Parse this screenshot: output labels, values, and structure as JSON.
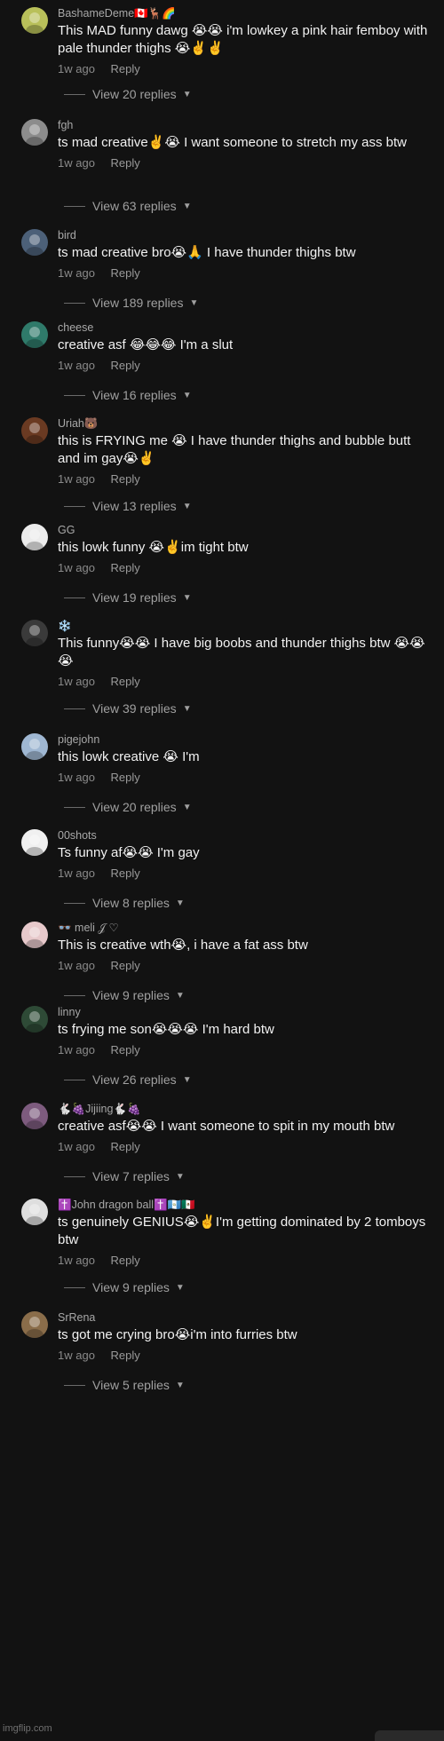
{
  "theme": {
    "background": "#121212",
    "text": "#f2f2f2",
    "muted": "#a8a8a8"
  },
  "comments": [
    {
      "username": "BashameDeme🇨🇦🦌🌈",
      "text": "This MAD funny dawg 😭😭 i'm lowkey a pink hair femboy with pale thunder thighs 😭✌️✌️",
      "time": "1w ago",
      "reply_label": "Reply",
      "replies_label": "View 20 replies",
      "avatar_color": "#b9c05a",
      "avatar_icon": "anime-avatar-icon"
    },
    {
      "username": "fgh",
      "text": "ts mad creative✌️😭 I want someone to stretch my ass btw",
      "time": "1w ago",
      "reply_label": "Reply",
      "replies_label": "View 63 replies",
      "avatar_color": "#8c8c8c",
      "avatar_icon": "person-avatar-icon"
    },
    {
      "username": "bird",
      "text": "ts mad creative bro😭🙏 I have thunder thighs btw",
      "time": "1w ago",
      "reply_label": "Reply",
      "replies_label": "View 189 replies",
      "avatar_color": "#4c6078",
      "avatar_icon": "bird-avatar-icon"
    },
    {
      "username": "cheese",
      "text": "creative asf 😂😂😂 I'm a slut",
      "time": "1w ago",
      "reply_label": "Reply",
      "replies_label": "View 16 replies",
      "avatar_color": "#2f7a6a",
      "avatar_icon": "smile-avatar-icon"
    },
    {
      "username": "Uriah🐻",
      "text": "this is FRYING me 😭 I have thunder thighs and bubble butt and im gay😭✌️",
      "time": "1w ago",
      "reply_label": "Reply",
      "replies_label": "View 13 replies",
      "avatar_color": "#6a3a22",
      "avatar_icon": "bear-avatar-icon"
    },
    {
      "username": "GG",
      "text": "this lowk funny 😭✌️im tight btw",
      "time": "1w ago",
      "reply_label": "Reply",
      "replies_label": "View 19 replies",
      "avatar_color": "#ececec",
      "avatar_icon": "mask-avatar-icon"
    },
    {
      "username": "❄️",
      "text": "This funny😭😭 I have big boobs and thunder thighs btw 😭😭😭",
      "time": "1w ago",
      "reply_label": "Reply",
      "replies_label": "View 39 replies",
      "avatar_color": "#3a3a3a",
      "avatar_icon": "dark-avatar-icon"
    },
    {
      "username": "pigejohn",
      "text": "this lowk creative 😭 I'm",
      "time": "1w ago",
      "reply_label": "Reply",
      "replies_label": "View 20 replies",
      "avatar_color": "#9fb7d2",
      "avatar_icon": "pigeon-avatar-icon"
    },
    {
      "username": "00shots",
      "text": "Ts funny af😭😭 I'm gay",
      "time": "1w ago",
      "reply_label": "Reply",
      "replies_label": "View 8 replies",
      "avatar_color": "#f0f0f0",
      "avatar_icon": "cartoon-avatar-icon"
    },
    {
      "username": "👓 meli 𝒥 ♡",
      "text": "This is creative wth😭, i have a fat ass btw",
      "time": "1w ago",
      "reply_label": "Reply",
      "replies_label": "View 9 replies",
      "avatar_color": "#e7c9cb",
      "avatar_icon": "pink-avatar-icon"
    },
    {
      "username": "linny",
      "text": "ts frying me son😭😭😭 I'm hard btw",
      "time": "1w ago",
      "reply_label": "Reply",
      "replies_label": "View 26 replies",
      "avatar_color": "#2e4a36",
      "avatar_icon": "girl-avatar-icon"
    },
    {
      "username": "🐇🍇Jijiing🐇🍇",
      "text": "creative asf😭😭 I want someone to spit in my mouth btw",
      "time": "1w ago",
      "reply_label": "Reply",
      "replies_label": "View 7 replies",
      "avatar_color": "#7d5b7e",
      "avatar_icon": "group-avatar-icon"
    },
    {
      "username": "✝️John dragon ball✝️🇬🇹🇲🇽",
      "text": "ts genuinely GENIUS😭✌️I'm getting dominated by 2 tomboys btw",
      "time": "1w ago",
      "reply_label": "Reply",
      "replies_label": "View 9 replies",
      "avatar_color": "#dedede",
      "avatar_icon": "goku-avatar-icon"
    },
    {
      "username": "SrRena",
      "text": "ts got me crying bro😭i'm into furries btw",
      "time": "1w ago",
      "reply_label": "Reply",
      "replies_label": "View 5 replies",
      "avatar_color": "#8a6d4a",
      "avatar_icon": "furry-avatar-icon"
    }
  ],
  "watermark": "imgflip.com"
}
